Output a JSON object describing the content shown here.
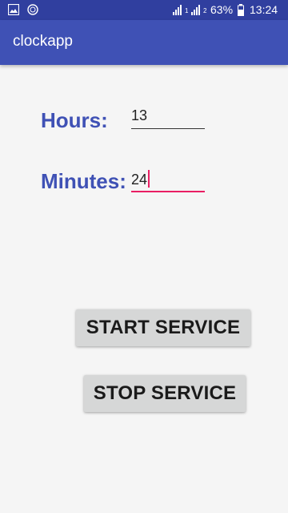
{
  "status_bar": {
    "battery_percent": "63%",
    "time": "13:24",
    "sim1_label": "1",
    "sim2_label": "2",
    "icons": [
      "image-icon",
      "sync-icon",
      "signal-sim1-icon",
      "signal-sim2-icon",
      "battery-icon"
    ]
  },
  "app_bar": {
    "title": "clockapp"
  },
  "form": {
    "hours_label": "Hours:",
    "hours_value": "13",
    "minutes_label": "Minutes:",
    "minutes_value": "24"
  },
  "buttons": {
    "start_label": "START SERVICE",
    "stop_label": "STOP SERVICE"
  },
  "colors": {
    "status_bar": "#303f9f",
    "app_bar": "#3f51b5",
    "accent": "#e91e63",
    "label_text": "#3f51b5",
    "button_bg": "#d6d7d7",
    "background": "#f5f5f5"
  }
}
